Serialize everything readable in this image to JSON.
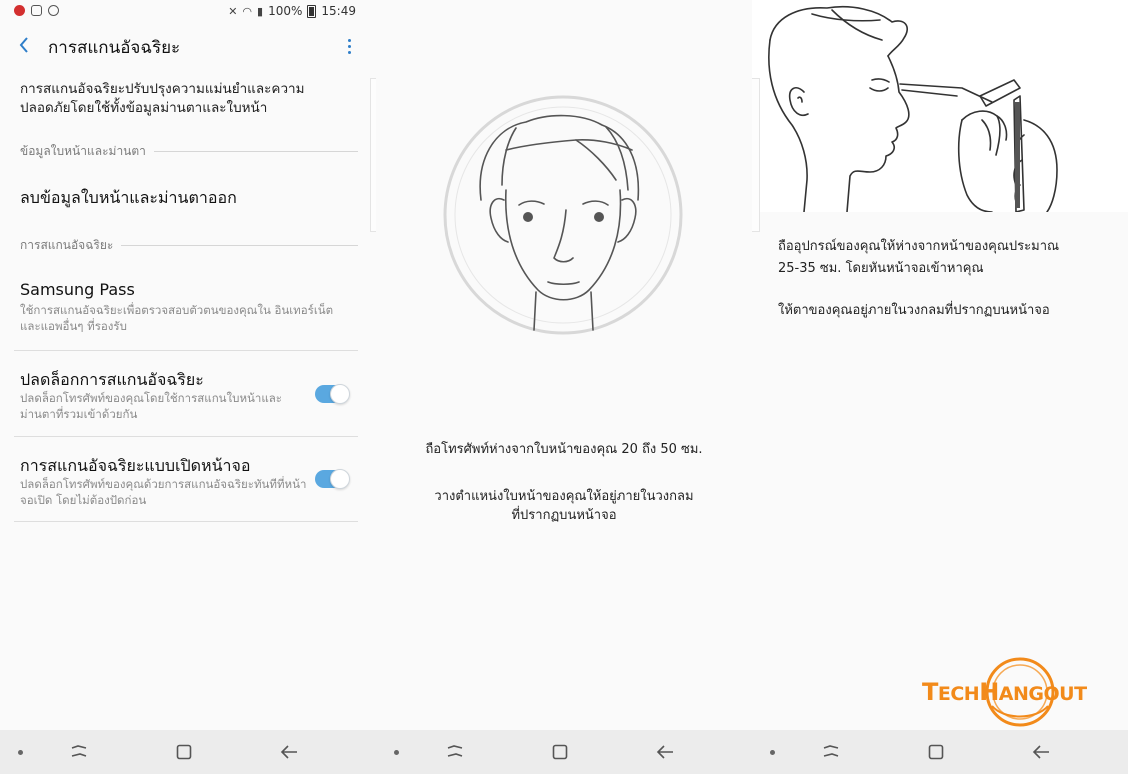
{
  "status": {
    "battery": "100%",
    "time": "15:49"
  },
  "header": {
    "title": "การสแกนอัจฉริยะ"
  },
  "settings": {
    "description": "การสแกนอัจฉริยะปรับปรุงความแม่นยำและความปลอดภัยโดยใช้ทั้งข้อมูลม่านตาและใบหน้า",
    "section_face_iris": "ข้อมูลใบหน้าและม่านตา",
    "remove_data": "ลบข้อมูลใบหน้าและม่านตาออก",
    "section_intelligent_scan": "การสแกนอัจฉริยะ",
    "samsung_pass_title": "Samsung Pass",
    "samsung_pass_sub": "ใช้การสแกนอัจฉริยะเพื่อตรวจสอบตัวตนของคุณใน อินเทอร์เน็ตและแอพอื่นๆ ที่รองรับ",
    "unlock_title": "ปลดล็อกการสแกนอัจฉริยะ",
    "unlock_sub": "ปลดล็อกโทรศัพท์ของคุณโดยใช้การสแกนใบหน้าและม่านตาที่รวมเข้าด้วยกัน",
    "unlock_on": true,
    "screen_on_title": "การสแกนอัจฉริยะแบบเปิดหน้าจอ",
    "screen_on_sub": "ปลดล็อกโทรศัพท์ของคุณด้วยการสแกนอัจฉริยะทันทีที่หน้าจอเปิด โดยไม่ต้องปัดก่อน",
    "screen_on_on": true
  },
  "guide_face": {
    "line1": "ถือโทรศัพท์ห่างจากใบหน้าของคุณ 20 ถึง 50 ซม.",
    "line2a": "วางตำแหน่งใบหน้าของคุณให้อยู่ภายในวงกลม",
    "line2b": "ที่ปรากฏบนหน้าจอ"
  },
  "guide_distance": {
    "line1a": "ถืออุปกรณ์ของคุณให้ห่างจากหน้าของคุณประมาณ",
    "line1b": "25-35 ซม. โดยหันหน้าจอเข้าหาคุณ",
    "line2": "ให้ตาของคุณอยู่ภายในวงกลมที่ปรากฏบนหน้าจอ"
  },
  "watermark": {
    "part1_big": "T",
    "part1_small": "ECH",
    "part2_big": "H",
    "part2_small": "ANGOUT"
  },
  "colors": {
    "accent": "#2f7ec9",
    "toggle_on": "#5aa8e0",
    "logo": "#f28a1a"
  }
}
